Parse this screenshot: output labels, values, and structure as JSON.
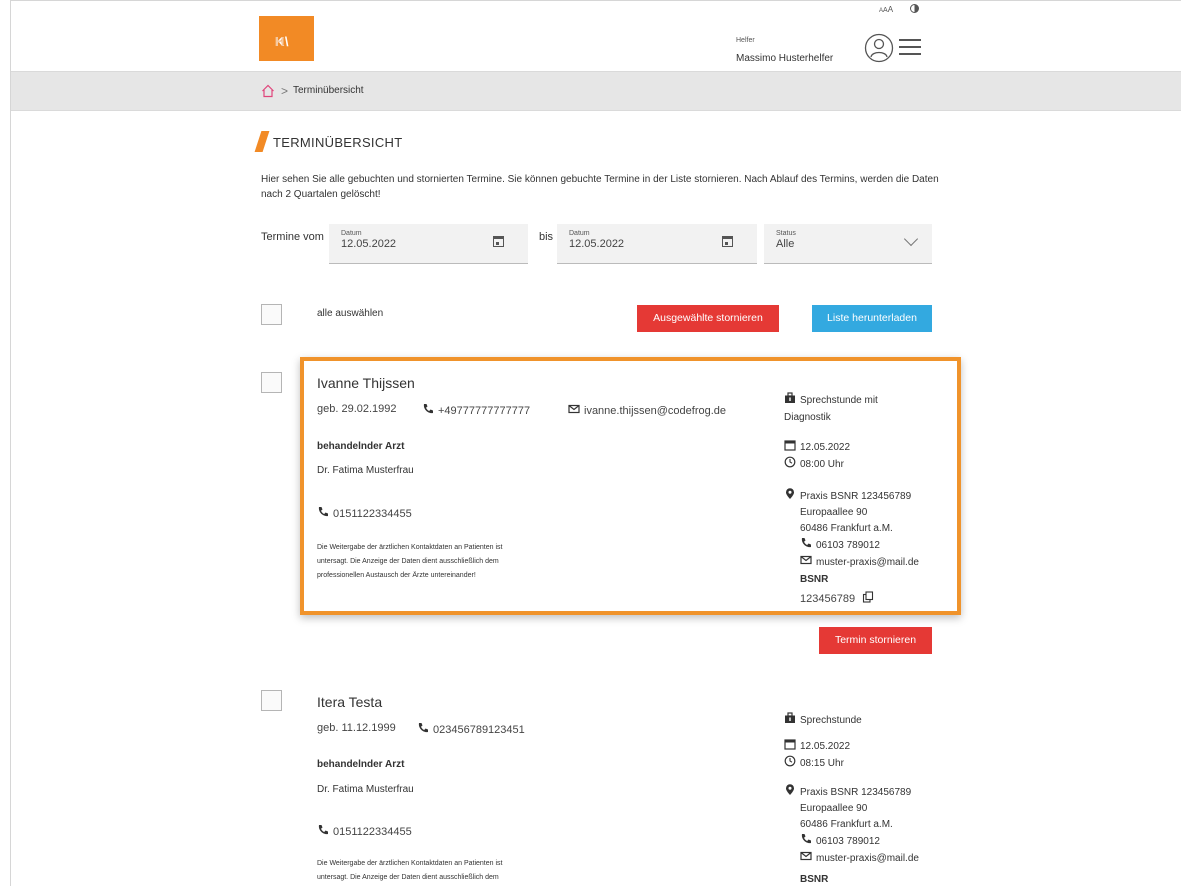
{
  "header": {
    "logo_text": "K\\",
    "logo_accent": "H",
    "access_label": "A",
    "access_label_small": "A",
    "access_label_tiny": "A",
    "user_role": "Helfer",
    "user_name": "Massimo Husterhelfer"
  },
  "breadcrumb": {
    "current": "Terminübersicht",
    "separator": ">"
  },
  "page": {
    "title": "TERMINÜBERSICHT",
    "intro": "Hier sehen Sie alle gebuchten und stornierten Termine. Sie können gebuchte Termine in der Liste stornieren. Nach Ablauf des Termins, werden die Daten nach 2 Quartalen gelöscht!"
  },
  "filters": {
    "from_label": "Termine vom",
    "to_label": "bis",
    "date_from": {
      "label": "Datum",
      "value": "12.05.2022"
    },
    "date_to": {
      "label": "Datum",
      "value": "12.05.2022"
    },
    "status": {
      "label": "Status",
      "value": "Alle"
    }
  },
  "actions": {
    "select_all": "alle auswählen",
    "cancel_selected": "Ausgewählte stornieren",
    "download_list": "Liste herunterladen"
  },
  "appointments": [
    {
      "name": "Ivanne Thijssen",
      "birth": "geb. 29.02.1992",
      "phone": "+49777777777777",
      "email": "ivanne.thijssen@codefrog.de",
      "doctor_heading": "behandelnder Arzt",
      "doctor_name": "Dr. Fatima Musterfrau",
      "doctor_phone": "0151122334455",
      "disclaimer_1": "Die Weitergabe der ärztlichen Kontaktdaten an Patienten ist",
      "disclaimer_2": "untersagt. Die Anzeige der Daten dient ausschließlich dem",
      "disclaimer_3": "professionellen Austausch der Ärzte untereinander!",
      "type_1": "Sprechstunde mit",
      "type_2": "Diagnostik",
      "date": "12.05.2022",
      "time": "08:00 Uhr",
      "practice": "Praxis BSNR 123456789",
      "street": "Europaallee 90",
      "city": "60486 Frankfurt a.M.",
      "practice_phone": "06103 789012",
      "practice_email": "muster-praxis@mail.de",
      "bsnr_label": "BSNR",
      "bsnr": "123456789",
      "cancel_button": "Termin stornieren"
    },
    {
      "name": "Itera Testa",
      "birth": "geb. 11.12.1999",
      "phone": "023456789123451",
      "doctor_heading": "behandelnder Arzt",
      "doctor_name": "Dr. Fatima Musterfrau",
      "doctor_phone": "0151122334455",
      "disclaimer_1": "Die Weitergabe der ärztlichen Kontaktdaten an Patienten ist",
      "disclaimer_2": "untersagt. Die Anzeige der Daten dient ausschließlich dem",
      "type_1": "Sprechstunde",
      "date": "12.05.2022",
      "time": "08:15 Uhr",
      "practice": "Praxis BSNR 123456789",
      "street": "Europaallee 90",
      "city": "60486 Frankfurt a.M.",
      "practice_phone": "06103 789012",
      "practice_email": "muster-praxis@mail.de",
      "bsnr_label": "BSNR"
    }
  ],
  "colors": {
    "accent": "#f28a25",
    "danger": "#e53935",
    "info": "#33a9e0",
    "highlight": "#f0932b"
  }
}
